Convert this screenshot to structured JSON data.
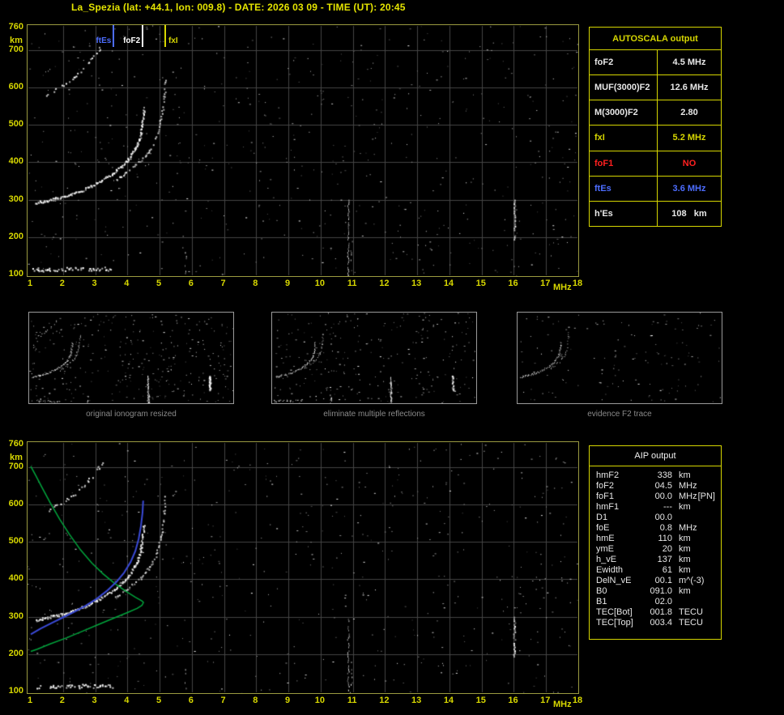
{
  "title": "La_Spezia (lat: +44.1, lon: 009.8) - DATE: 2026 03 09 - TIME (UT): 20:45",
  "axes": {
    "x_ticks": [
      1,
      2,
      3,
      4,
      5,
      6,
      7,
      8,
      9,
      10,
      11,
      12,
      13,
      14,
      15,
      16,
      17,
      18
    ],
    "x_unit": "MHz",
    "y_ticks": [
      760,
      700,
      600,
      500,
      400,
      300,
      200,
      100
    ],
    "y_unit": "km"
  },
  "markers": [
    {
      "label": "ftEs",
      "freq_mhz": 3.6,
      "color": "#4d6dff",
      "side": "left"
    },
    {
      "label": "foF2",
      "freq_mhz": 4.5,
      "color": "#ffffff",
      "side": "left"
    },
    {
      "label": "fxI",
      "freq_mhz": 5.2,
      "color": "#d6d600",
      "side": "right"
    }
  ],
  "autoscala": {
    "header": "AUTOSCALA output",
    "rows": [
      {
        "label": "foF2",
        "value": "4.5 MHz",
        "color": "white"
      },
      {
        "label": "MUF(3000)F2",
        "value": "12.6 MHz",
        "color": "white"
      },
      {
        "label": "M(3000)F2",
        "value": "2.80",
        "color": "white"
      },
      {
        "label": "fxI",
        "value": "5.2 MHz",
        "color": "yellow"
      },
      {
        "label": "foF1",
        "value": "NO",
        "color": "red"
      },
      {
        "label": "ftEs",
        "value": "3.6 MHz",
        "color": "blue"
      },
      {
        "label": "h'Es",
        "value": "108   km",
        "color": "white"
      }
    ]
  },
  "thumbnails": [
    {
      "caption": "original ionogram resized"
    },
    {
      "caption": "eliminate multiple reflections"
    },
    {
      "caption": "evidence F2 trace"
    }
  ],
  "aip": {
    "header": "AIP output",
    "rows": [
      {
        "name": "hmF2",
        "value": "338",
        "unit": "km",
        "extra": ""
      },
      {
        "name": "foF2",
        "value": "04.5",
        "unit": "MHz",
        "extra": ""
      },
      {
        "name": "foF1",
        "value": "00.0",
        "unit": "MHz",
        "extra": "[PN]"
      },
      {
        "name": "hmF1",
        "value": "---",
        "unit": "km",
        "extra": ""
      },
      {
        "name": "D1",
        "value": "00.0",
        "unit": "",
        "extra": ""
      },
      {
        "name": "foE",
        "value": "0.8",
        "unit": "MHz",
        "extra": ""
      },
      {
        "name": "hmE",
        "value": "110",
        "unit": "km",
        "extra": ""
      },
      {
        "name": "ymE",
        "value": "20",
        "unit": "km",
        "extra": ""
      },
      {
        "name": "h_vE",
        "value": "137",
        "unit": "km",
        "extra": ""
      },
      {
        "name": "Ewidth",
        "value": "61",
        "unit": "km",
        "extra": ""
      },
      {
        "name": "DelN_vE",
        "value": "00.1",
        "unit": "m^(-3)",
        "extra": ""
      },
      {
        "name": "B0",
        "value": "091.0",
        "unit": "km",
        "extra": ""
      },
      {
        "name": "B1",
        "value": "02.0",
        "unit": "",
        "extra": ""
      },
      {
        "name": "TEC[Bot]",
        "value": "001.8",
        "unit": "TECU",
        "extra": ""
      },
      {
        "name": "TEC[Top]",
        "value": "003.4",
        "unit": "TECU",
        "extra": ""
      }
    ]
  },
  "chart_data": [
    {
      "type": "scatter",
      "title": "ionogram echo traces (top panel, repeated in bottom panel and thumbnails)",
      "xlabel": "MHz",
      "ylabel": "km",
      "xlim": [
        1,
        18
      ],
      "ylim": [
        100,
        760
      ],
      "grid": true,
      "series": [
        {
          "name": "F2 ordinary trace",
          "points": [
            [
              1.15,
              292
            ],
            [
              1.5,
              299
            ],
            [
              1.9,
              307
            ],
            [
              2.3,
              317
            ],
            [
              2.7,
              330
            ],
            [
              3.1,
              347
            ],
            [
              3.5,
              368
            ],
            [
              3.8,
              390
            ],
            [
              4.05,
              412
            ],
            [
              4.25,
              440
            ],
            [
              4.38,
              470
            ],
            [
              4.45,
              505
            ],
            [
              4.5,
              545
            ]
          ]
        },
        {
          "name": "F2 extraordinary trace",
          "points": [
            [
              3.6,
              352
            ],
            [
              3.9,
              370
            ],
            [
              4.2,
              390
            ],
            [
              4.5,
              412
            ],
            [
              4.7,
              436
            ],
            [
              4.85,
              462
            ],
            [
              4.97,
              495
            ],
            [
              5.07,
              535
            ],
            [
              5.13,
              580
            ],
            [
              5.17,
              625
            ]
          ]
        },
        {
          "name": "second hop F2 trace",
          "points": [
            [
              1.5,
              582
            ],
            [
              1.8,
              598
            ],
            [
              2.1,
              614
            ],
            [
              2.4,
              633
            ],
            [
              2.65,
              652
            ],
            [
              2.85,
              672
            ],
            [
              3.05,
              695
            ],
            [
              3.25,
              718
            ]
          ]
        },
        {
          "name": "sporadic E trace",
          "points": [
            [
              1.05,
              114
            ],
            [
              2.2,
              115
            ],
            [
              3.5,
              116
            ]
          ]
        }
      ],
      "interference_columns": [
        {
          "f": 10.85,
          "km": [
            100,
            300
          ],
          "density": 0.75
        },
        {
          "f": 10.95,
          "km": [
            100,
            190
          ],
          "density": 0.3
        },
        {
          "f": 16.0,
          "km": [
            195,
            300
          ],
          "density": 0.85,
          "size": 2
        },
        {
          "f": 5.8,
          "km": [
            100,
            170
          ],
          "density": 0.3
        }
      ],
      "scaled_parameters": {
        "foF2_MHz": 4.5,
        "MUF3000F2_MHz": 12.6,
        "M3000F2": 2.8,
        "fxI_MHz": 5.2,
        "foF1": "NO",
        "ftEs_MHz": 3.6,
        "hpEs_km": 108
      }
    },
    {
      "type": "line",
      "title": "AIP reconstructed profile and restored trace (bottom panel overlays)",
      "xlabel": "MHz",
      "ylabel": "km",
      "xlim": [
        1,
        18
      ],
      "ylim": [
        100,
        760
      ],
      "series": [
        {
          "name": "electron density profile",
          "color": "#00a53c",
          "points": [
            [
              1.0,
              702
            ],
            [
              1.15,
              678
            ],
            [
              1.35,
              645
            ],
            [
              1.6,
              605
            ],
            [
              1.9,
              560
            ],
            [
              2.2,
              520
            ],
            [
              2.55,
              478
            ],
            [
              2.9,
              443
            ],
            [
              3.25,
              414
            ],
            [
              3.6,
              389
            ],
            [
              3.95,
              368
            ],
            [
              4.25,
              352
            ],
            [
              4.45,
              342
            ],
            [
              4.5,
              338
            ],
            [
              4.45,
              330
            ],
            [
              4.3,
              322
            ],
            [
              4.0,
              311
            ],
            [
              3.6,
              297
            ],
            [
              3.1,
              279
            ],
            [
              2.6,
              261
            ],
            [
              2.1,
              243
            ],
            [
              1.6,
              227
            ],
            [
              1.2,
              213
            ],
            [
              1.0,
              207
            ]
          ]
        },
        {
          "name": "restored trace",
          "color": "#3a4ad6",
          "points": [
            [
              1.0,
              253
            ],
            [
              1.3,
              268
            ],
            [
              1.65,
              283
            ],
            [
              2.0,
              298
            ],
            [
              2.35,
              313
            ],
            [
              2.7,
              329
            ],
            [
              3.05,
              348
            ],
            [
              3.35,
              368
            ],
            [
              3.65,
              392
            ],
            [
              3.9,
              418
            ],
            [
              4.1,
              446
            ],
            [
              4.25,
              476
            ],
            [
              4.35,
              508
            ],
            [
              4.42,
              542
            ],
            [
              4.47,
              578
            ],
            [
              4.49,
              610
            ]
          ]
        }
      ]
    }
  ]
}
